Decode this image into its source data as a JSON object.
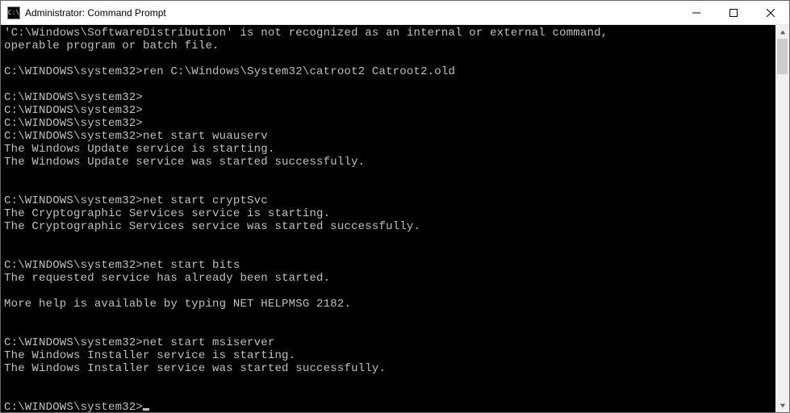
{
  "window": {
    "title": "Administrator: Command Prompt",
    "icon_label": "cmd-icon"
  },
  "terminal": {
    "lines": [
      "'C:\\Windows\\SoftwareDistribution' is not recognized as an internal or external command,",
      "operable program or batch file.",
      "",
      "C:\\WINDOWS\\system32>ren C:\\Windows\\System32\\catroot2 Catroot2.old",
      "",
      "C:\\WINDOWS\\system32>",
      "C:\\WINDOWS\\system32>",
      "C:\\WINDOWS\\system32>",
      "C:\\WINDOWS\\system32>net start wuauserv",
      "The Windows Update service is starting.",
      "The Windows Update service was started successfully.",
      "",
      "",
      "C:\\WINDOWS\\system32>net start cryptSvc",
      "The Cryptographic Services service is starting.",
      "The Cryptographic Services service was started successfully.",
      "",
      "",
      "C:\\WINDOWS\\system32>net start bits",
      "The requested service has already been started.",
      "",
      "More help is available by typing NET HELPMSG 2182.",
      "",
      "",
      "C:\\WINDOWS\\system32>net start msiserver",
      "The Windows Installer service is starting.",
      "The Windows Installer service was started successfully.",
      "",
      "",
      "C:\\WINDOWS\\system32>"
    ],
    "prompt": "C:\\WINDOWS\\system32>"
  }
}
